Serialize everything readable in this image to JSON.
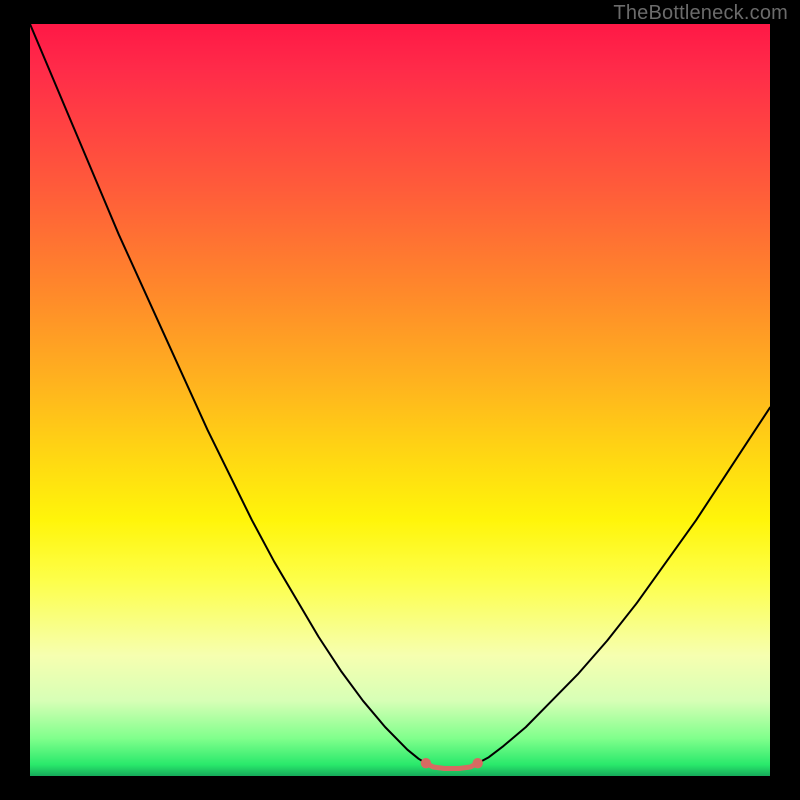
{
  "watermark": "TheBottleneck.com",
  "chart_data": {
    "type": "line",
    "title": "",
    "xlabel": "",
    "ylabel": "",
    "xlim": [
      0,
      100
    ],
    "ylim": [
      0,
      100
    ],
    "grid": false,
    "gradient_stops": [
      {
        "pos": 0,
        "color": "#ff1846"
      },
      {
        "pos": 6,
        "color": "#ff2b49"
      },
      {
        "pos": 22,
        "color": "#ff5c3a"
      },
      {
        "pos": 36,
        "color": "#ff8a2a"
      },
      {
        "pos": 48,
        "color": "#ffb41e"
      },
      {
        "pos": 58,
        "color": "#ffd912"
      },
      {
        "pos": 66,
        "color": "#fff50a"
      },
      {
        "pos": 74,
        "color": "#fdff4a"
      },
      {
        "pos": 84,
        "color": "#f6ffb0"
      },
      {
        "pos": 90,
        "color": "#d7ffb6"
      },
      {
        "pos": 95,
        "color": "#80ff8c"
      },
      {
        "pos": 98.5,
        "color": "#29e96b"
      },
      {
        "pos": 100,
        "color": "#16aa5a"
      }
    ],
    "series": [
      {
        "name": "left-curve",
        "stroke": "#000000",
        "stroke_width": 2,
        "x": [
          0.0,
          3.0,
          6.0,
          9.0,
          12.0,
          15.0,
          18.0,
          21.0,
          24.0,
          27.0,
          30.0,
          33.0,
          36.0,
          39.0,
          42.0,
          45.0,
          48.0,
          51.0,
          52.5,
          53.5
        ],
        "y": [
          100.0,
          93.0,
          86.0,
          79.0,
          72.0,
          65.5,
          59.0,
          52.5,
          46.0,
          40.0,
          34.0,
          28.5,
          23.5,
          18.5,
          14.0,
          10.0,
          6.5,
          3.5,
          2.3,
          1.7
        ]
      },
      {
        "name": "right-curve",
        "stroke": "#000000",
        "stroke_width": 2,
        "x": [
          60.5,
          62.0,
          64.0,
          67.0,
          70.0,
          74.0,
          78.0,
          82.0,
          86.0,
          90.0,
          94.0,
          97.0,
          99.0,
          100.0
        ],
        "y": [
          1.7,
          2.5,
          4.0,
          6.5,
          9.5,
          13.5,
          18.0,
          23.0,
          28.5,
          34.0,
          40.0,
          44.5,
          47.5,
          49.0
        ]
      },
      {
        "name": "valley-segment",
        "stroke": "#d86a62",
        "stroke_width": 5,
        "x": [
          53.5,
          54.5,
          56.0,
          58.0,
          59.5,
          60.5
        ],
        "y": [
          1.7,
          1.2,
          1.0,
          1.0,
          1.2,
          1.7
        ]
      }
    ],
    "markers": [
      {
        "name": "valley-dot-left",
        "x": 53.5,
        "y": 1.7,
        "r": 0.7,
        "color": "#d86a62"
      },
      {
        "name": "valley-dot-right",
        "x": 60.5,
        "y": 1.7,
        "r": 0.7,
        "color": "#d86a62"
      }
    ]
  }
}
